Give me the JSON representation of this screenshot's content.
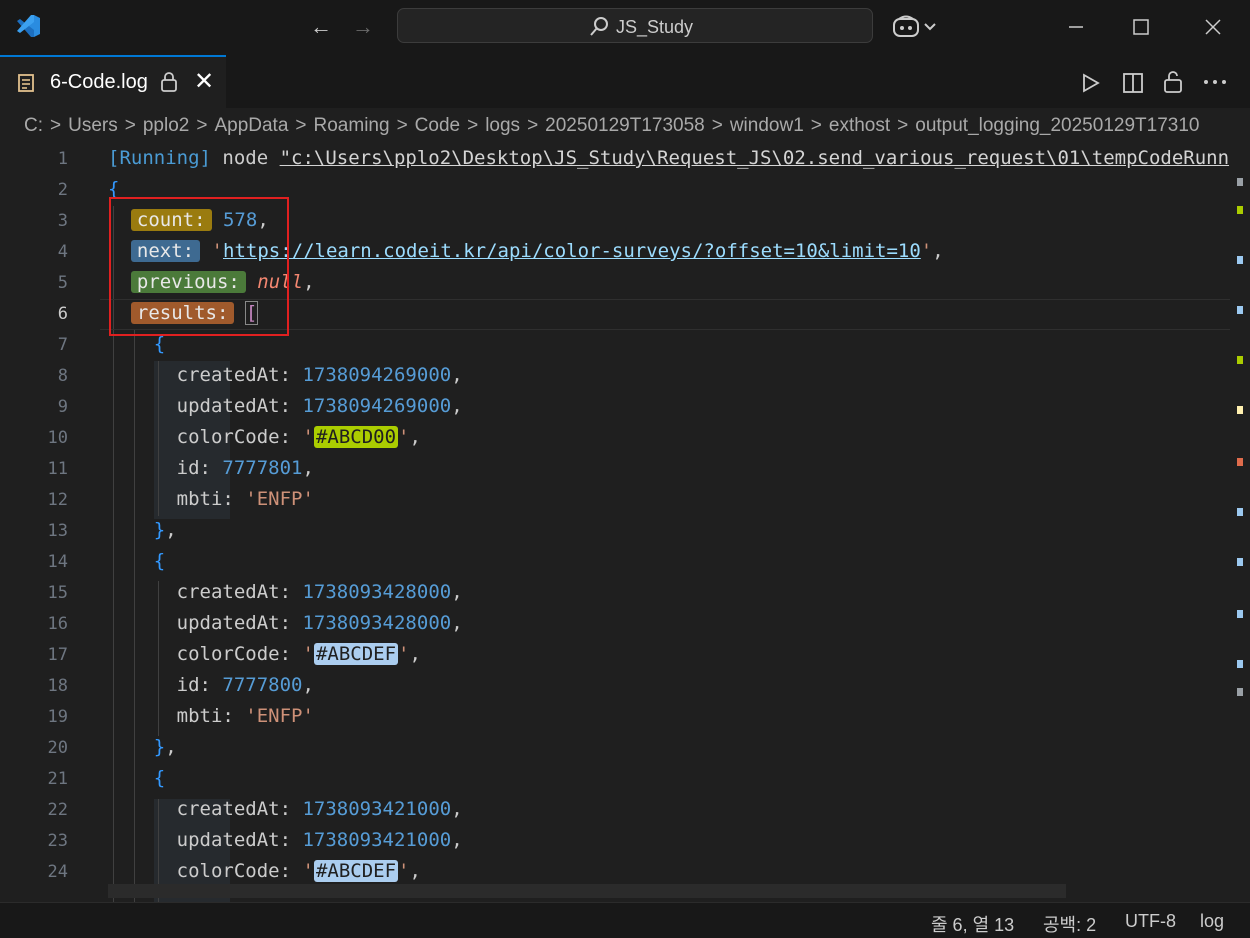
{
  "titlebar": {
    "command_center": "JS_Study",
    "back": "←",
    "forward": "→"
  },
  "tab": {
    "label": "6-Code.log",
    "close": "✕"
  },
  "breadcrumb": [
    "C:",
    "Users",
    "pplo2",
    "AppData",
    "Roaming",
    "Code",
    "logs",
    "20250129T173058",
    "window1",
    "exthost",
    "output_logging_20250129T17310"
  ],
  "editor": {
    "line_numbers": [
      "1",
      "2",
      "3",
      "4",
      "5",
      "6",
      "7",
      "8",
      "9",
      "10",
      "11",
      "12",
      "13",
      "14",
      "15",
      "16",
      "17",
      "18",
      "19",
      "20",
      "21",
      "22",
      "23",
      "24"
    ],
    "active_line": "6",
    "run_prefix": "[Running]",
    "run_cmd": " node ",
    "run_path": "\"c:\\Users\\pplo2\\Desktop\\JS_Study\\Request_JS\\02.send_various_request\\01\\tempCodeRunn",
    "open_brace": "{",
    "count_key": "count:",
    "count_val": "578",
    "next_key": "next:",
    "next_url": "https://learn.codeit.kr/api/color-surveys/?offset=10&limit=10",
    "previous_key": "previous:",
    "previous_val": "null",
    "results_key": "results:",
    "results_open": "[",
    "items": [
      {
        "createdAt": "1738094269000",
        "updatedAt": "1738094269000",
        "colorCode": "#ABCD00",
        "id": "7777801",
        "mbti": "'ENFP'"
      },
      {
        "createdAt": "1738093428000",
        "updatedAt": "1738093428000",
        "colorCode": "#ABCDEF",
        "id": "7777800",
        "mbti": "'ENFP'"
      },
      {
        "createdAt": "1738093421000",
        "updatedAt": "1738093421000",
        "colorCode": "#ABCDEF"
      }
    ],
    "labels": {
      "createdAt": "createdAt:",
      "updatedAt": "updatedAt:",
      "colorCode": "colorCode:",
      "id": "id:",
      "mbti": "mbti:"
    }
  },
  "statusbar": {
    "position": "줄 6, 열 13",
    "spaces": "공백: 2",
    "encoding": "UTF-8",
    "language": "log"
  },
  "colors": {
    "accent": "#0078d4",
    "chip_abcd00": "#abcd00",
    "chip_abcdef": "#abcdef",
    "highlight_box": "#e02020"
  }
}
